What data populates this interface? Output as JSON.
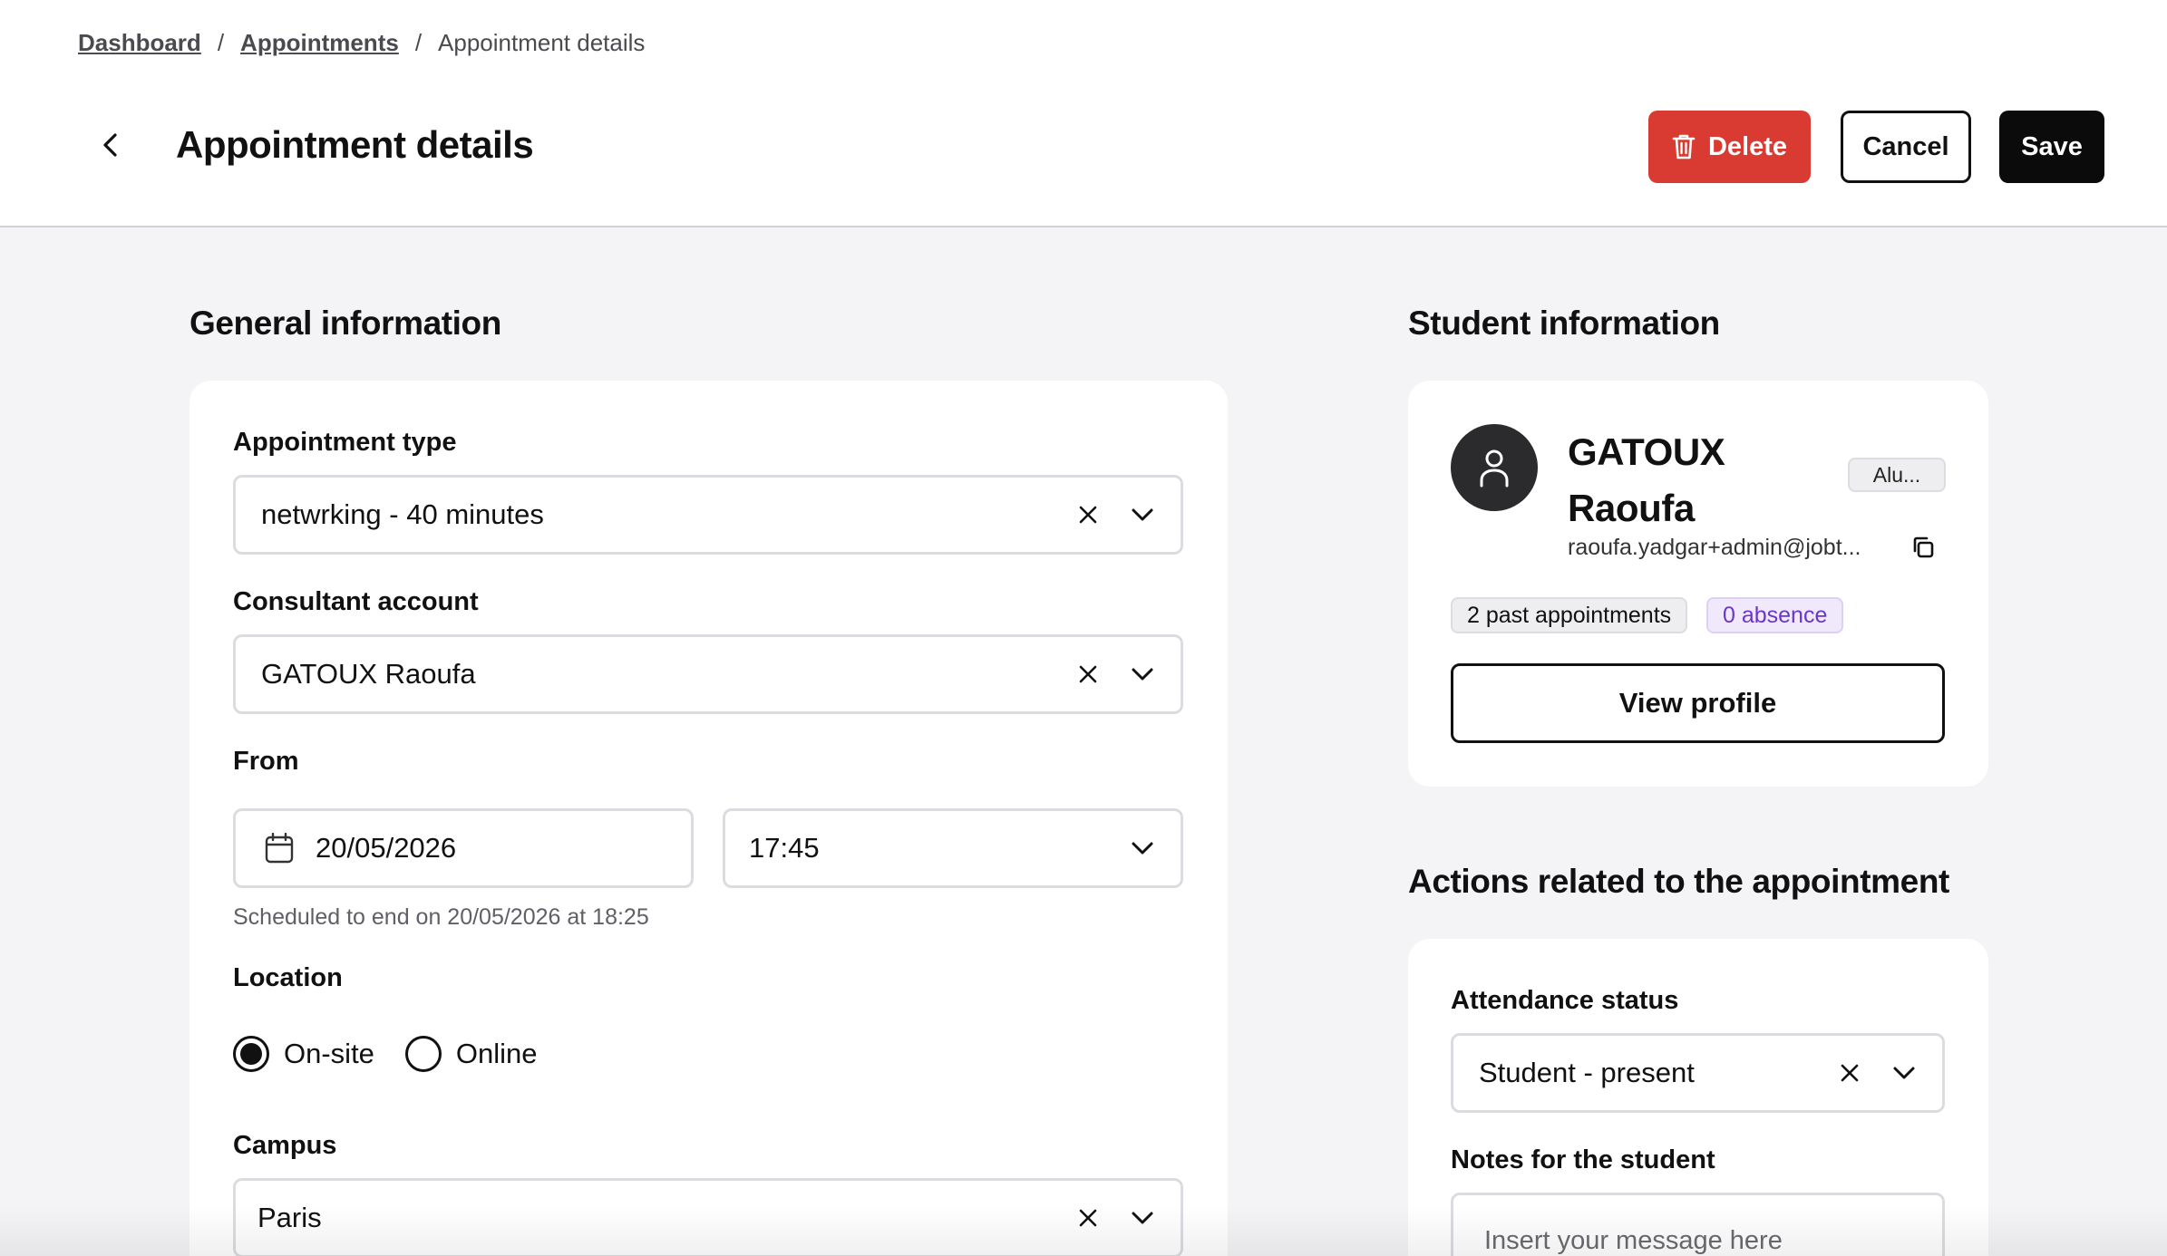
{
  "breadcrumb": {
    "items": [
      "Dashboard",
      "Appointments"
    ],
    "current": "Appointment details",
    "separator": "/"
  },
  "header": {
    "title": "Appointment details",
    "delete_label": "Delete",
    "cancel_label": "Cancel",
    "save_label": "Save"
  },
  "general": {
    "title": "General information",
    "appointment_type": {
      "label": "Appointment type",
      "value": "netwrking - 40 minutes"
    },
    "consultant": {
      "label": "Consultant account",
      "value": "GATOUX Raoufa"
    },
    "from": {
      "label": "From",
      "date": "20/05/2026",
      "time": "17:45"
    },
    "end_hint": "Scheduled to end on 20/05/2026 at 18:25",
    "location": {
      "label": "Location",
      "options": [
        "On-site",
        "Online"
      ],
      "selected": "On-site"
    },
    "campus": {
      "label": "Campus",
      "value": "Paris"
    }
  },
  "student": {
    "title": "Student information",
    "name_line1": "GATOUX",
    "name_line2": "Raoufa",
    "role": "Alu...",
    "email": "raoufa.yadgar+admin@jobt...",
    "past_appointments": "2 past appointments",
    "absences": "0 absence",
    "view_profile_label": "View profile"
  },
  "actions": {
    "title": "Actions related to the appointment",
    "attendance": {
      "label": "Attendance status",
      "value": "Student - present"
    },
    "notes": {
      "label": "Notes for the student",
      "placeholder": "Insert your message here"
    }
  },
  "colors": {
    "danger": "#d93a31",
    "primary": "#0b0b0c",
    "background": "#f4f4f6",
    "absence_text": "#6a37c6",
    "absence_bg": "#efe9fb"
  }
}
